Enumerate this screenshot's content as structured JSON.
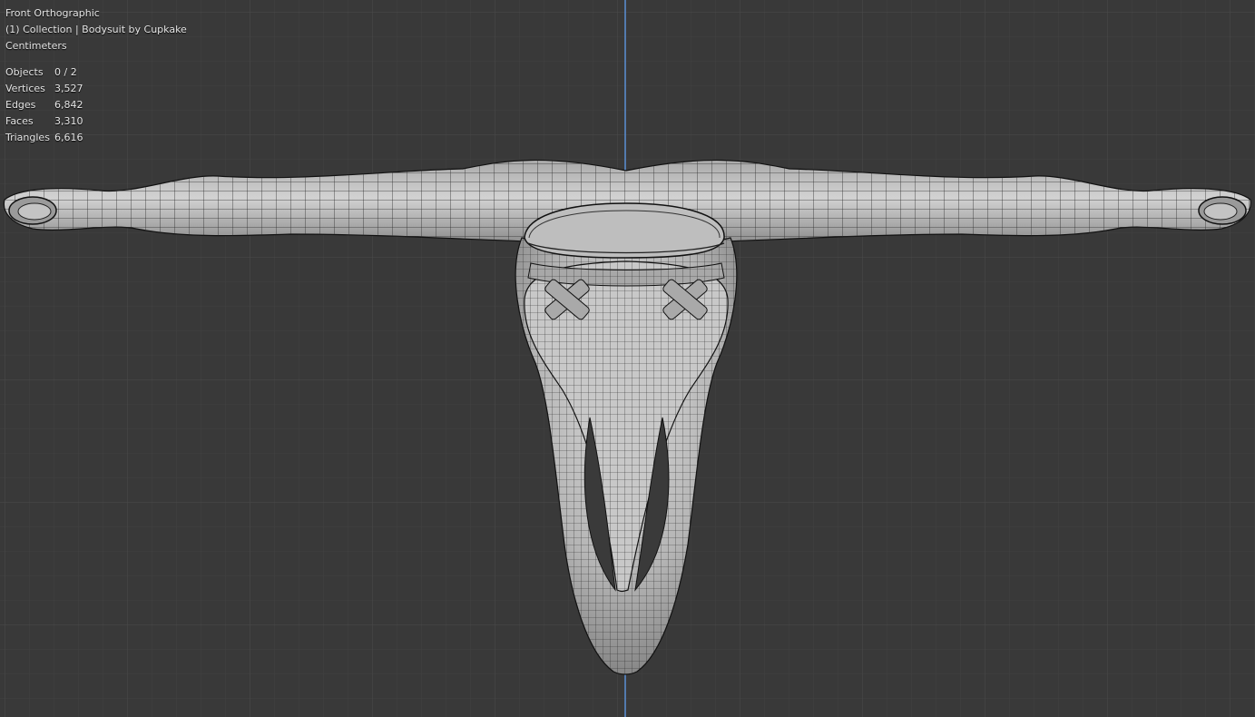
{
  "viewport": {
    "view_name": "Front Orthographic",
    "collection_label": "(1) Collection | Bodysuit by Cupkake",
    "units": "Centimeters"
  },
  "stats": [
    {
      "label": "Objects",
      "value": "0 / 2"
    },
    {
      "label": "Vertices",
      "value": "3,527"
    },
    {
      "label": "Edges",
      "value": "6,842"
    },
    {
      "label": "Faces",
      "value": "3,310"
    },
    {
      "label": "Triangles",
      "value": "6,616"
    }
  ],
  "colors": {
    "background": "#393939",
    "grid_minor": "#414141",
    "grid_major": "#4a4a4a",
    "z_axis": "#5a8fd6",
    "mesh_fill": "#bdbdbd",
    "mesh_wire": "#111111"
  }
}
